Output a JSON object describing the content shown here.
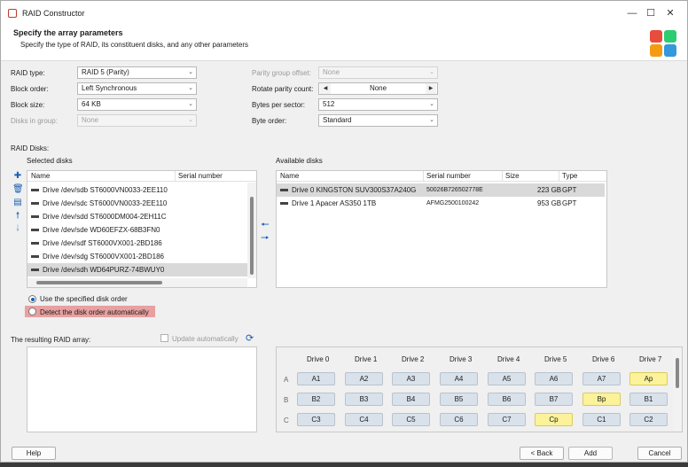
{
  "window": {
    "title": "RAID Constructor"
  },
  "header": {
    "title": "Specify the array parameters",
    "subtitle": "Specify the type of RAID, its constituent disks, and any other parameters"
  },
  "params": {
    "raid_type": {
      "label": "RAID type:",
      "value": "RAID 5 (Parity)"
    },
    "block_order": {
      "label": "Block order:",
      "value": "Left Synchronous"
    },
    "block_size": {
      "label": "Block size:",
      "value": "64 KB"
    },
    "disks_in_group": {
      "label": "Disks in group:",
      "value": "None"
    },
    "parity_group_offset": {
      "label": "Parity group offset:",
      "value": "None"
    },
    "rotate_parity_count": {
      "label": "Rotate parity count:",
      "value": "None"
    },
    "bytes_per_sector": {
      "label": "Bytes per sector:",
      "value": "512"
    },
    "byte_order": {
      "label": "Byte order:",
      "value": "Standard"
    }
  },
  "raid_disks_label": "RAID Disks:",
  "selected": {
    "label": "Selected disks",
    "columns": [
      "Name",
      "Serial number"
    ],
    "rows": [
      "Drive /dev/sdb ST6000VN0033-2EE110",
      "Drive /dev/sdc ST6000VN0033-2EE110",
      "Drive /dev/sdd ST6000DM004-2EH11C",
      "Drive /dev/sde WD60EFZX-68B3FN0",
      "Drive /dev/sdf ST6000VX001-2BD186",
      "Drive /dev/sdg ST6000VX001-2BD186",
      "Drive /dev/sdh WD64PURZ-74BWUY0"
    ]
  },
  "available": {
    "label": "Available disks",
    "columns": [
      "Name",
      "Serial number",
      "Size",
      "Type"
    ],
    "rows": [
      {
        "name": "Drive 0 KINGSTON SUV300S37A240G",
        "serial": "50026B726502778E",
        "size": "223 GB",
        "type": "GPT"
      },
      {
        "name": "Drive 1 Apacer AS350 1TB",
        "serial": "AFMG2500100242",
        "size": "953 GB",
        "type": "GPT"
      }
    ]
  },
  "order": {
    "use_specified": "Use the specified disk order",
    "detect_auto": "Detect the disk order automatically"
  },
  "result": {
    "label": "The resulting RAID array:",
    "update_auto": "Update automatically"
  },
  "layout": {
    "drives": [
      "Drive 0",
      "Drive 1",
      "Drive 2",
      "Drive 3",
      "Drive 4",
      "Drive 5",
      "Drive 6",
      "Drive 7"
    ],
    "rows": [
      {
        "label": "A",
        "cells": [
          "A1",
          "A2",
          "A3",
          "A4",
          "A5",
          "A6",
          "A7",
          "Ap"
        ]
      },
      {
        "label": "B",
        "cells": [
          "B2",
          "B3",
          "B4",
          "B5",
          "B6",
          "B7",
          "Bp",
          "B1"
        ]
      },
      {
        "label": "C",
        "cells": [
          "C3",
          "C4",
          "C5",
          "C6",
          "C7",
          "Cp",
          "C1",
          "C2"
        ]
      }
    ]
  },
  "buttons": {
    "help": "Help",
    "back": "< Back",
    "add": "Add",
    "cancel": "Cancel"
  },
  "colors": {
    "parity": "#fbf29a",
    "data": "#d9e1ea",
    "highlight": "#e8a0a0",
    "accent": "#1a5fb4"
  }
}
